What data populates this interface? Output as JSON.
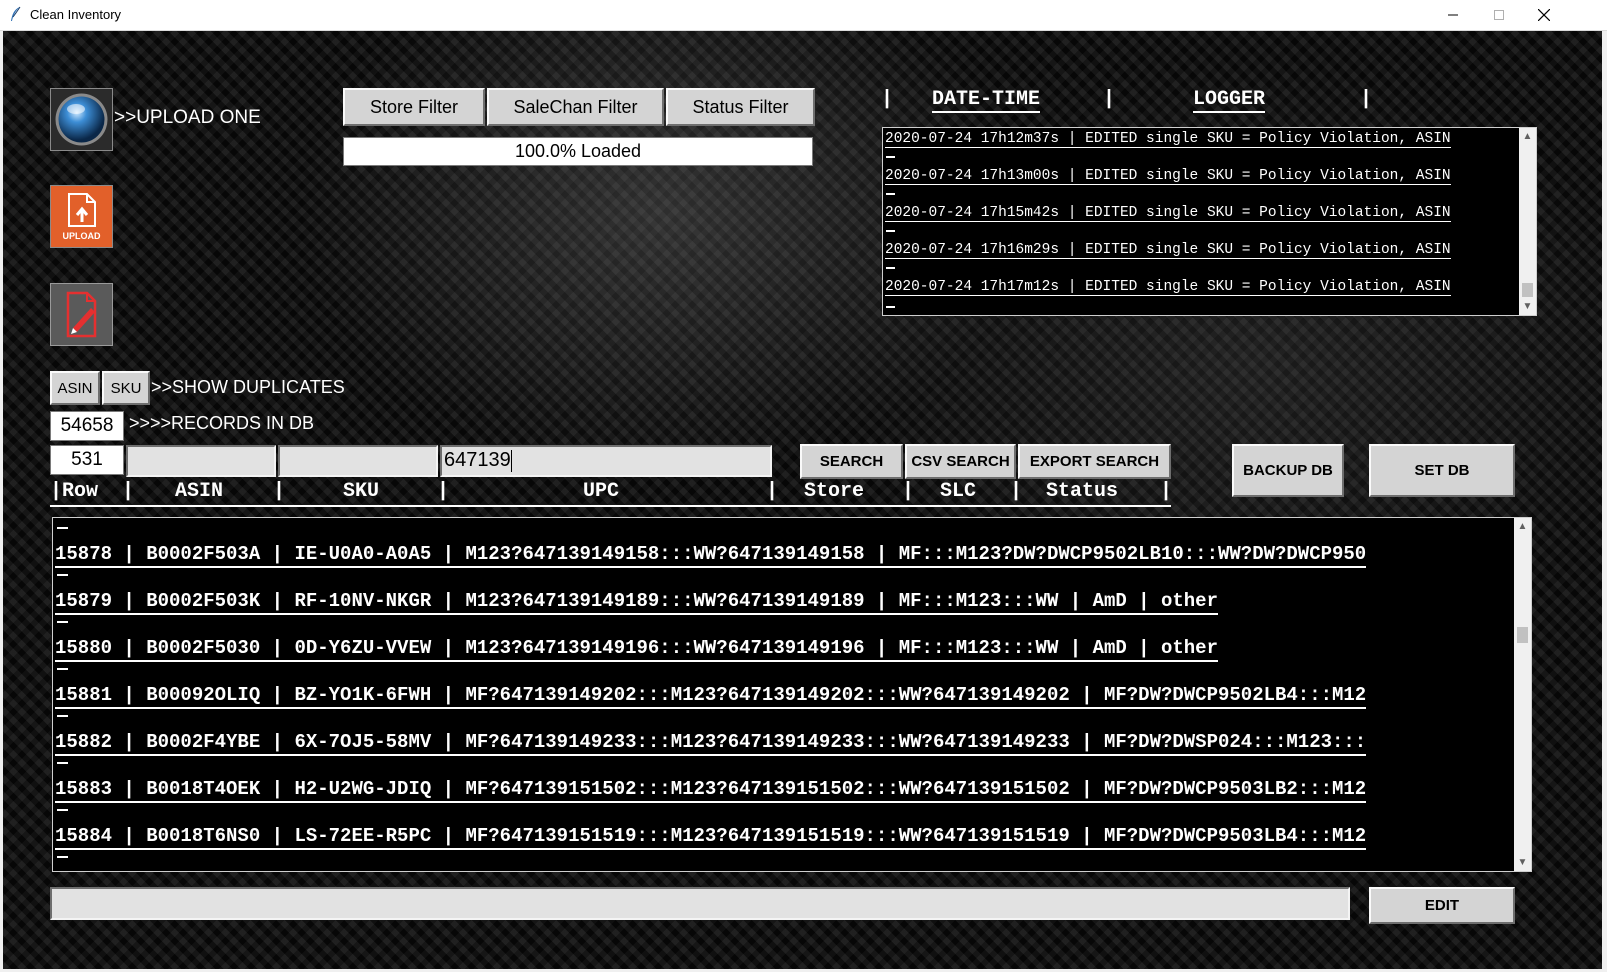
{
  "window": {
    "title": "Clean Inventory",
    "controls": {
      "minimize": "minimize-icon",
      "maximize": "maximize-icon",
      "close": "close-icon"
    }
  },
  "icons": {
    "app": "feather-icon",
    "upload_one": "globe-icon",
    "upload": "upload-file-icon",
    "edit_file": "edit-file-icon"
  },
  "upload_one_label": ">>UPLOAD ONE",
  "upload_icon_text": "UPLOAD",
  "filters": {
    "store": "Store Filter",
    "salechan": "SaleChan Filter",
    "status": "Status Filter",
    "progress_text": "100.0% Loaded",
    "progress_fraction": 1.0
  },
  "duplicates": {
    "asin": "ASIN",
    "sku": "SKU",
    "label": ">>SHOW DUPLICATES"
  },
  "records": {
    "count": "54658",
    "label": ">>>>RECORDS IN DB"
  },
  "search": {
    "row_value": "531",
    "asin_value": "",
    "sku_value": "",
    "upc_value": "647139",
    "search_btn": "SEARCH",
    "csv_btn": "CSV SEARCH",
    "export_btn": "EXPORT SEARCH"
  },
  "db": {
    "backup": "BACKUP DB",
    "set": "SET DB"
  },
  "columns": {
    "row": "|Row",
    "asin": "ASIN",
    "sku": "SKU",
    "upc": "UPC",
    "store": "Store",
    "slc": "SLC",
    "status": "Status"
  },
  "logger": {
    "header_datetime": "DATE-TIME",
    "header_logger": "LOGGER",
    "lines": [
      "2020-07-24 17h12m37s | EDITED single SKU = Policy Violation, ASIN",
      "2020-07-24 17h13m00s | EDITED single SKU = Policy Violation, ASIN",
      "2020-07-24 17h15m42s | EDITED single SKU = Policy Violation, ASIN",
      "2020-07-24 17h16m29s | EDITED single SKU = Policy Violation, ASIN",
      "2020-07-24 17h17m12s | EDITED single SKU = Policy Violation, ASIN"
    ]
  },
  "records_list": [
    "15878 | B0002F503A | IE-U0A0-A0A5 | M123?647139149158:::WW?647139149158 | MF:::M123?DW?DWCP9502LB10:::WW?DW?DWCP950",
    "15879 | B0002F503K | RF-10NV-NKGR | M123?647139149189:::WW?647139149189 | MF:::M123:::WW | AmD | other",
    "15880 | B0002F5030 | 0D-Y6ZU-VVEW | M123?647139149196:::WW?647139149196 | MF:::M123:::WW | AmD | other",
    "15881 | B00092OLIQ | BZ-YO1K-6FWH | MF?647139149202:::M123?647139149202:::WW?647139149202 | MF?DW?DWCP9502LB4:::M12",
    "15882 | B0002F4YBE | 6X-7OJ5-58MV | MF?647139149233:::M123?647139149233:::WW?647139149233 | MF?DW?DWSP024:::M123:::",
    "15883 | B0018T4OEK | H2-U2WG-JDIQ | MF?647139151502:::M123?647139151502:::WW?647139151502 | MF?DW?DWCP9503LB2:::M12",
    "15884 | B0018T6NS0 | LS-72EE-R5PC | MF?647139151519:::M123?647139151519:::WW?647139151519 | MF?DW?DWCP9503LB4:::M12"
  ],
  "edit": {
    "value": "",
    "button": "EDIT"
  }
}
